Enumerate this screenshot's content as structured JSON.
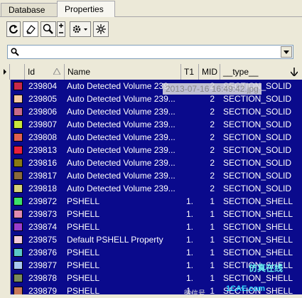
{
  "tabs": [
    {
      "label": "Database"
    },
    {
      "label": "Properties"
    }
  ],
  "toolbar": {
    "icons": [
      "refresh-icon",
      "eraser-icon",
      "zoom-icon",
      "stepper-icon",
      "gear-dropdown-icon",
      "sparkle-icon"
    ]
  },
  "search": {
    "value": "",
    "placeholder": ""
  },
  "columns": {
    "id": "Id",
    "name": "Name",
    "t1": "T1",
    "mid": "MID",
    "type": "__type__"
  },
  "rows": [
    {
      "color": "#c8284a",
      "id": "239804",
      "name": "Auto Detected Volume 239...",
      "t1": "",
      "mid": "2",
      "type": "SECTION_SOLID"
    },
    {
      "color": "#f2c7a0",
      "id": "239805",
      "name": "Auto Detected Volume 239...",
      "t1": "",
      "mid": "2",
      "type": "SECTION_SOLID"
    },
    {
      "color": "#c86a8a",
      "id": "239806",
      "name": "Auto Detected Volume 239...",
      "t1": "",
      "mid": "2",
      "type": "SECTION_SOLID"
    },
    {
      "color": "#c8e63c",
      "id": "239807",
      "name": "Auto Detected Volume 239...",
      "t1": "",
      "mid": "2",
      "type": "SECTION_SOLID"
    },
    {
      "color": "#e06050",
      "id": "239808",
      "name": "Auto Detected Volume 239...",
      "t1": "",
      "mid": "2",
      "type": "SECTION_SOLID"
    },
    {
      "color": "#e8203c",
      "id": "239813",
      "name": "Auto Detected Volume 239...",
      "t1": "",
      "mid": "2",
      "type": "SECTION_SOLID"
    },
    {
      "color": "#8a7a14",
      "id": "239816",
      "name": "Auto Detected Volume 239...",
      "t1": "",
      "mid": "2",
      "type": "SECTION_SOLID"
    },
    {
      "color": "#8a6a3c",
      "id": "239817",
      "name": "Auto Detected Volume 239...",
      "t1": "",
      "mid": "2",
      "type": "SECTION_SOLID"
    },
    {
      "color": "#d6d27a",
      "id": "239818",
      "name": "Auto Detected Volume 239...",
      "t1": "",
      "mid": "2",
      "type": "SECTION_SOLID"
    },
    {
      "color": "#3ce06a",
      "id": "239872",
      "name": "PSHELL",
      "t1": "1.",
      "mid": "1",
      "type": "SECTION_SHELL"
    },
    {
      "color": "#e08ab0",
      "id": "239873",
      "name": "PSHELL",
      "t1": "1.",
      "mid": "1",
      "type": "SECTION_SHELL"
    },
    {
      "color": "#9a3ccc",
      "id": "239874",
      "name": "PSHELL",
      "t1": "1.",
      "mid": "1",
      "type": "SECTION_SHELL"
    },
    {
      "color": "#f0c8d8",
      "id": "239875",
      "name": "Default PSHELL Property",
      "t1": "1.",
      "mid": "1",
      "type": "SECTION_SHELL"
    },
    {
      "color": "#5ac8c8",
      "id": "239876",
      "name": "PSHELL",
      "t1": "1.",
      "mid": "1",
      "type": "SECTION_SHELL"
    },
    {
      "color": "#a8c8f0",
      "id": "239877",
      "name": "PSHELL",
      "t1": "1.",
      "mid": "1",
      "type": "SECTION_SHELL"
    },
    {
      "color": "#7a8a5a",
      "id": "239878",
      "name": "PSHELL",
      "t1": "1.",
      "mid": "1",
      "type": "SECTION_SHELL"
    },
    {
      "color": "#c87a5a",
      "id": "239879",
      "name": "PSHELL",
      "t1": "1.",
      "mid": "1",
      "type": "SECTION_SHELL"
    }
  ],
  "overlay": {
    "timestamp": "2013-07-16 16:49:42.jpg"
  },
  "watermark": {
    "wechat": "微信号",
    "site": "1CAE.com",
    "brand": "仿真在线"
  }
}
